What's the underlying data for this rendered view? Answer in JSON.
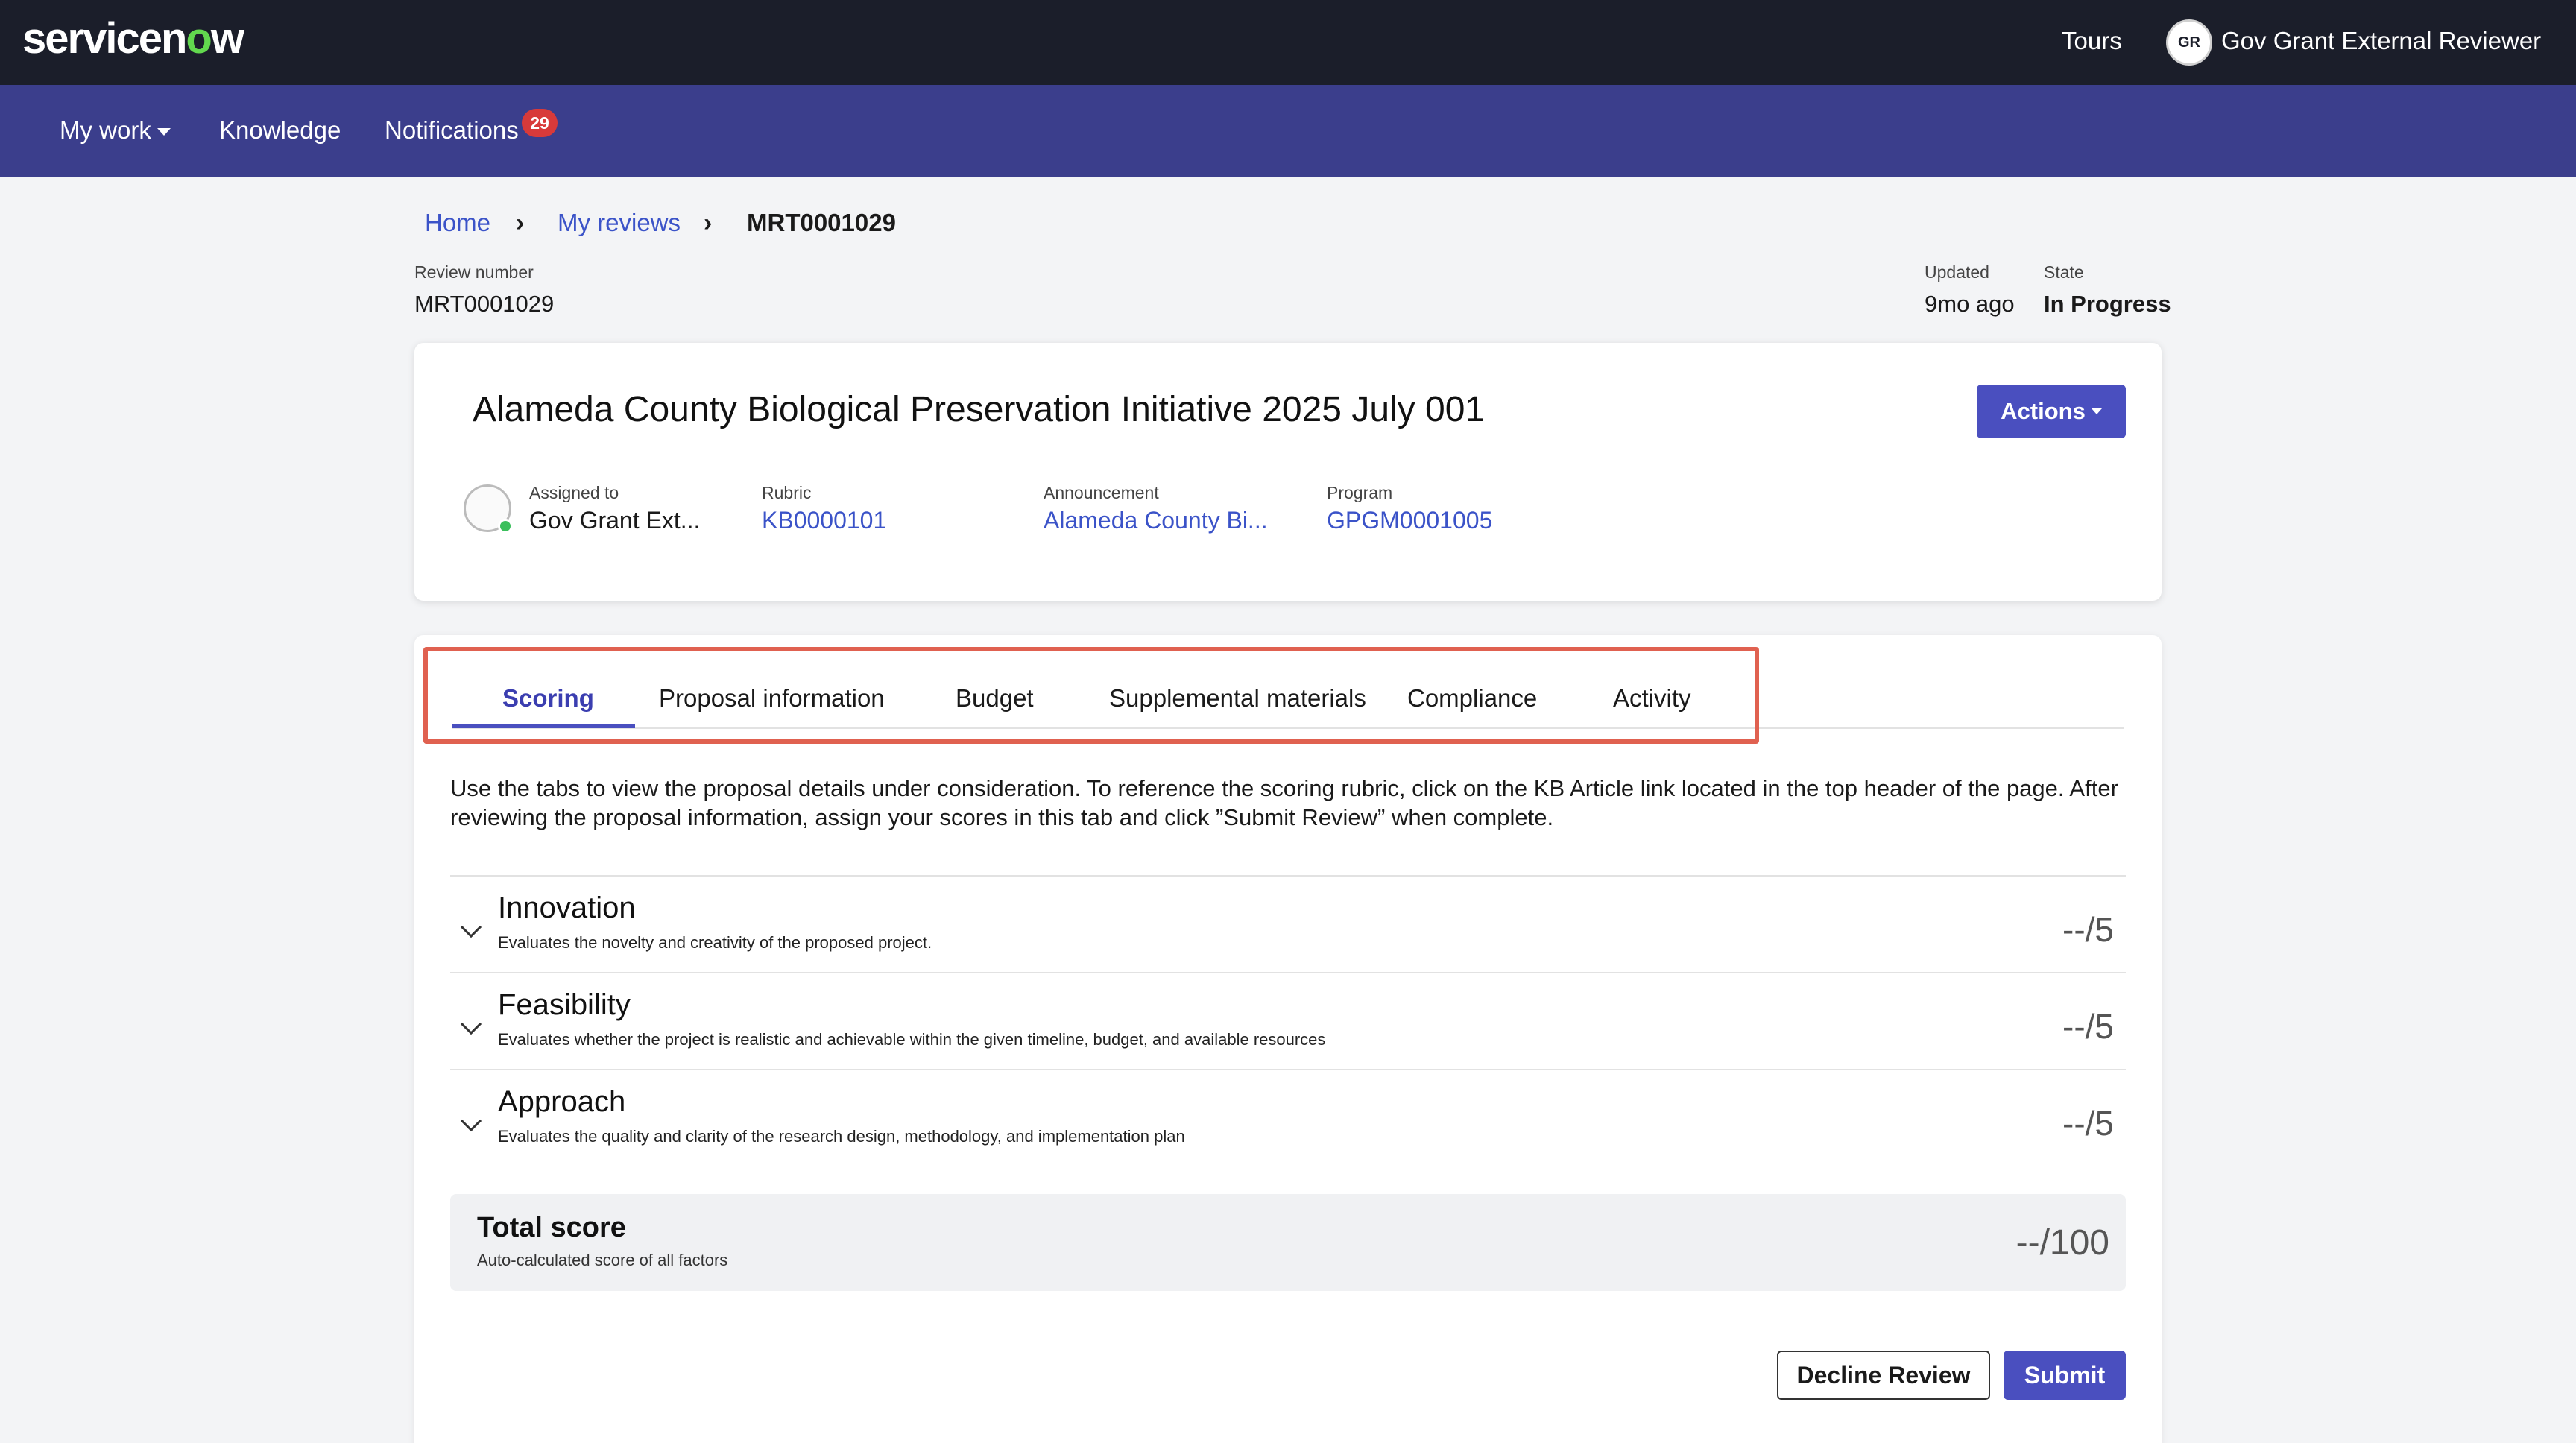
{
  "brand": {
    "logo_prefix": "servicen",
    "logo_mark": "o",
    "logo_suffix": "w"
  },
  "topbar": {
    "tours": "Tours",
    "avatar_initials": "GR",
    "user_name": "Gov Grant External Reviewer"
  },
  "nav": {
    "my_work": "My work",
    "knowledge": "Knowledge",
    "notifications": "Notifications",
    "notifications_count": "29"
  },
  "breadcrumb": {
    "home": "Home",
    "my_reviews": "My reviews",
    "current": "MRT0001029"
  },
  "review": {
    "number_label": "Review number",
    "number": "MRT0001029",
    "updated_label": "Updated",
    "updated": "9mo ago",
    "state_label": "State",
    "state": "In Progress"
  },
  "header": {
    "title": "Alameda County Biological Preservation Initiative 2025 July 001",
    "actions": "Actions",
    "assigned_label": "Assigned to",
    "assigned": "Gov Grant Ext...",
    "rubric_label": "Rubric",
    "rubric": "KB0000101",
    "announcement_label": "Announcement",
    "announcement": "Alameda County Bi...",
    "program_label": "Program",
    "program": "GPGM0001005"
  },
  "tabs": [
    "Scoring",
    "Proposal information",
    "Budget",
    "Supplemental materials",
    "Compliance",
    "Activity"
  ],
  "active_tab": "Scoring",
  "intro": "Use the tabs to view the proposal details under consideration. To reference the scoring rubric, click on the KB Article link located in the top header of the page. After reviewing the proposal information, assign your scores in this tab and click ”Submit Review” when complete.",
  "criteria": [
    {
      "name": "Innovation",
      "description": "Evaluates the novelty and creativity of the proposed project.",
      "score": "--/5"
    },
    {
      "name": "Feasibility",
      "description": "Evaluates whether the project is realistic and achievable within the given timeline, budget, and available resources",
      "score": "--/5"
    },
    {
      "name": "Approach",
      "description": "Evaluates the quality and clarity of the research design, methodology, and implementation plan",
      "score": "--/5"
    }
  ],
  "total": {
    "title": "Total score",
    "subtitle": "Auto-calculated score of all factors",
    "score": "--/100"
  },
  "buttons": {
    "decline": "Decline Review",
    "submit": "Submit"
  },
  "colors": {
    "topbar": "#1b1e2a",
    "navbar": "#3b3e8c",
    "accent": "#4a4fbf",
    "link": "#3b53c8",
    "highlight": "#e06150",
    "badge": "#d83a3a",
    "presence": "#3bbf5c"
  },
  "icons": [
    "chevron-down-icon",
    "chevron-right-icon",
    "presence-dot-icon"
  ]
}
